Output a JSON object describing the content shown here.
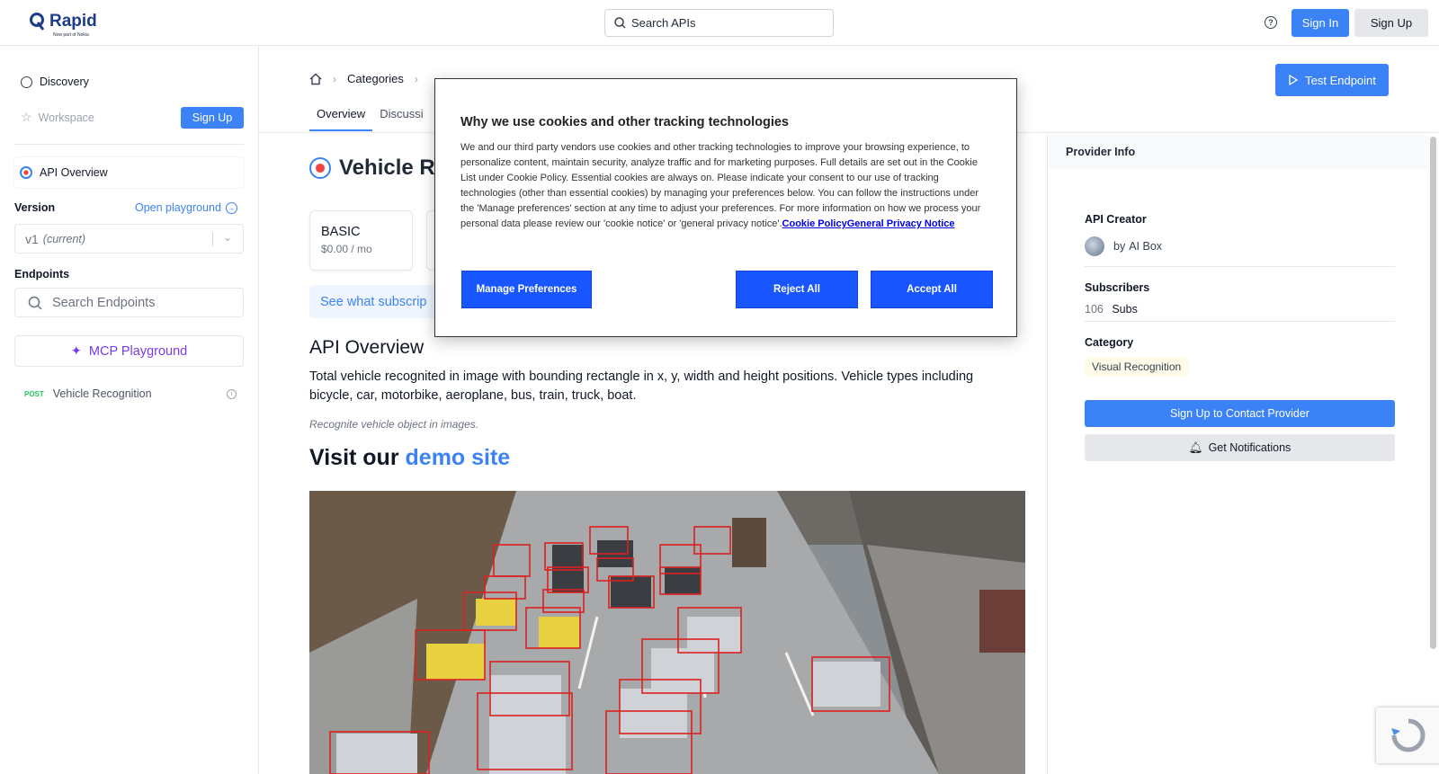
{
  "header": {
    "logo_text": "Rapid",
    "logo_sub": "Now part of Nokia",
    "search_placeholder": "Search APIs",
    "help_icon": "help-circle-icon",
    "sign_in": "Sign In",
    "sign_up": "Sign Up"
  },
  "sidebar": {
    "discovery": "Discovery",
    "workspace": "Workspace",
    "signup": "Sign Up",
    "api_overview": "API Overview",
    "version_label": "Version",
    "open_playground": "Open playground",
    "version_value": "v1",
    "version_note": "(current)",
    "endpoints_label": "Endpoints",
    "search_endpoints": "Search Endpoints",
    "mcp_playground": "MCP Playground",
    "endpoint": {
      "method": "POST",
      "name": "Vehicle Recognition"
    }
  },
  "main": {
    "breadcrumb": [
      "Categories"
    ],
    "tabs": [
      "Overview",
      "Discussi"
    ],
    "test_endpoint": "Test Endpoint",
    "title": "Vehicle Re",
    "plan": {
      "name": "BASIC",
      "price": "$0.00 / mo"
    },
    "subs_banner": "See what subscrip",
    "overview_heading": "API Overview",
    "description": "Total vehicle recognited in image with bounding rectangle in x, y, width and height positions. Vehicle types including bicycle, car, motorbike, aeroplane, bus, train, truck, boat.",
    "short_desc": "Recognite vehicle object in images.",
    "demo_prefix": "Visit our ",
    "demo_link": "demo site"
  },
  "provider": {
    "header": "Provider Info",
    "creator_label": "API Creator",
    "creator_by": "by",
    "creator_name": "AI Box",
    "subscribers_label": "Subscribers",
    "subscribers_count": "106",
    "subscribers_unit": "Subs",
    "category_label": "Category",
    "category": "Visual Recognition",
    "contact_btn": "Sign Up to Contact Provider",
    "notify_btn": "Get Notifications"
  },
  "cookie": {
    "title": "Why we use cookies and other tracking technologies",
    "body": "We and our third party vendors use cookies and other tracking technologies to improve your browsing experience, to personalize content, maintain security, analyze traffic and for marketing purposes. Full details are set out in the Cookie List under Cookie Policy. Essential cookies are always on. Please indicate your consent to our use of tracking technologies (other than essential cookies) by managing your preferences below. You can follow the instructions under the 'Manage preferences' section at any time to adjust your preferences. For more information on how we process your personal data please review our 'cookie notice' or 'general privacy notice'.",
    "link1": "Cookie Policy",
    "link2": "General Privacy Notice",
    "manage": "Manage Preferences",
    "reject": "Reject All",
    "accept": "Accept All"
  },
  "colors": {
    "accent": "#3b82f6",
    "cookie_button": "#1a56ff",
    "mcp": "#7c3aed"
  }
}
